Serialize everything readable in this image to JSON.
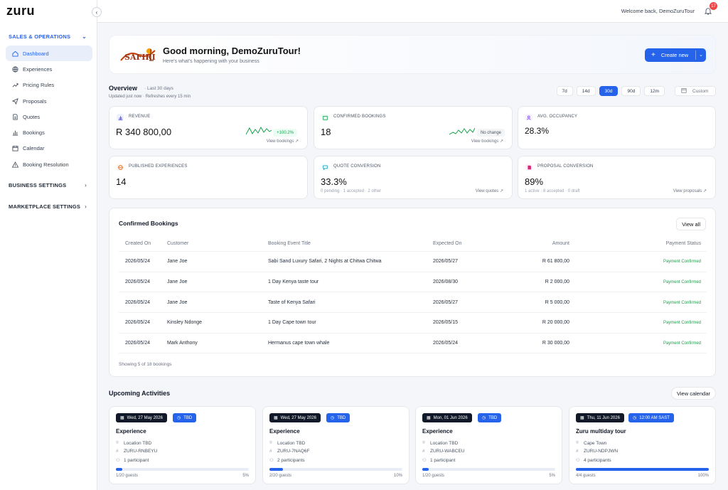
{
  "app": {
    "logo": "zuru"
  },
  "header": {
    "welcome": "Welcome back, DemoZuruTour",
    "notifications": "17"
  },
  "sidebar": {
    "sections": [
      {
        "label": "SALES & OPERATIONS"
      },
      {
        "label": "BUSINESS SETTINGS"
      },
      {
        "label": "MARKETPLACE SETTINGS"
      }
    ],
    "items": [
      {
        "label": "Dashboard",
        "icon": "home-icon"
      },
      {
        "label": "Experiences",
        "icon": "globe-icon"
      },
      {
        "label": "Pricing Rules",
        "icon": "trend-icon"
      },
      {
        "label": "Proposals",
        "icon": "send-icon"
      },
      {
        "label": "Quotes",
        "icon": "file-icon"
      },
      {
        "label": "Bookings",
        "icon": "bar-chart-icon"
      },
      {
        "label": "Calendar",
        "icon": "calendar-icon"
      },
      {
        "label": "Booking Resolution",
        "icon": "alert-icon"
      }
    ]
  },
  "hero": {
    "brand": "SAFIRI",
    "title": "Good morning, DemoZuruTour!",
    "subtitle": "Here's what's happening with your business",
    "create_label": "Create new"
  },
  "overview": {
    "title": "Overview",
    "range": "· Last 30 days",
    "updated": "Updated just now · Refreshes every 15 min",
    "ranges": [
      "7d",
      "14d",
      "30d",
      "90d",
      "12m"
    ],
    "active_range": "30d",
    "custom_label": "Custom"
  },
  "stats": [
    {
      "label": "REVENUE",
      "value": "R 340 800,00",
      "badge": "+100.2%",
      "link": "View bookings ↗"
    },
    {
      "label": "CONFIRMED BOOKINGS",
      "value": "18",
      "badge": "No change",
      "link": "View bookings ↗"
    },
    {
      "label": "AVG. OCCUPANCY",
      "value": "28.3%"
    },
    {
      "label": "PUBLISHED EXPERIENCES",
      "value": "14"
    },
    {
      "label": "QUOTE CONVERSION",
      "value": "33.3%",
      "foot": "0 pending · 1 accepted · 2 other",
      "link": "View quotes ↗"
    },
    {
      "label": "PROPOSAL CONVERSION",
      "value": "89%",
      "foot": "1 active · 8 accepted · 0 draft",
      "link": "View proposals ↗"
    }
  ],
  "bookings": {
    "title": "Confirmed Bookings",
    "view_all": "View all",
    "columns": [
      "Created On",
      "Customer",
      "Booking Event Title",
      "Expected On",
      "Amount",
      "Payment Status"
    ],
    "rows": [
      [
        "2026/05/24",
        "Jane Joe",
        "Sabi Sand Luxury Safari, 2 Nights at Chitwa Chitwa",
        "2026/05/27",
        "R 61 800,00",
        "Payment Confirmed"
      ],
      [
        "2026/05/24",
        "Jane Joe",
        "1 Day Kenya taste tour",
        "2026/08/30",
        "R 2 000,00",
        "Payment Confirmed"
      ],
      [
        "2026/05/24",
        "Jane Joe",
        "Taste of Kenya Safari",
        "2026/05/27",
        "R 5 000,00",
        "Payment Confirmed"
      ],
      [
        "2026/05/24",
        "Kinsley Ndonge",
        "1 Day Cape town tour",
        "2026/05/15",
        "R 20 000,00",
        "Payment Confirmed"
      ],
      [
        "2026/05/24",
        "Mark Anthony",
        "Hermanus cape town whale",
        "2026/05/24",
        "R 30 000,00",
        "Payment Confirmed"
      ]
    ],
    "footer": "Showing 5 of 18 bookings"
  },
  "activities": {
    "title": "Upcoming Activities",
    "view_calendar": "View calendar",
    "cards": [
      {
        "date": "Wed, 27 May 2026",
        "time": "TBD",
        "name": "Experience",
        "location": "Location TBD",
        "code": "ZURU-RNBEYU",
        "participants": "1 participant",
        "guests": "1/20 guests",
        "pct": "5%",
        "fill": 0.05
      },
      {
        "date": "Wed, 27 May 2026",
        "time": "TBD",
        "name": "Experience",
        "location": "Location TBD",
        "code": "ZURU-7NAQ6F",
        "participants": "2 participants",
        "guests": "2/20 guests",
        "pct": "10%",
        "fill": 0.1
      },
      {
        "date": "Mon, 01 Jun 2026",
        "time": "TBD",
        "name": "Experience",
        "location": "Location TBD",
        "code": "ZURU-WABCEU",
        "participants": "1 participant",
        "guests": "1/20 guests",
        "pct": "5%",
        "fill": 0.05
      },
      {
        "date": "Thu, 11 Jun 2026",
        "time": "12:00 AM SAST",
        "name": "Zuru multiday tour",
        "location": "Cape Town",
        "code": "ZURU-NDPJWN",
        "participants": "4 participants",
        "guests": "4/4 guests",
        "pct": "100%",
        "fill": 1.0
      }
    ]
  },
  "colors": {
    "accent": "#2563eb",
    "success": "#16a34a",
    "danger": "#ef4444"
  }
}
